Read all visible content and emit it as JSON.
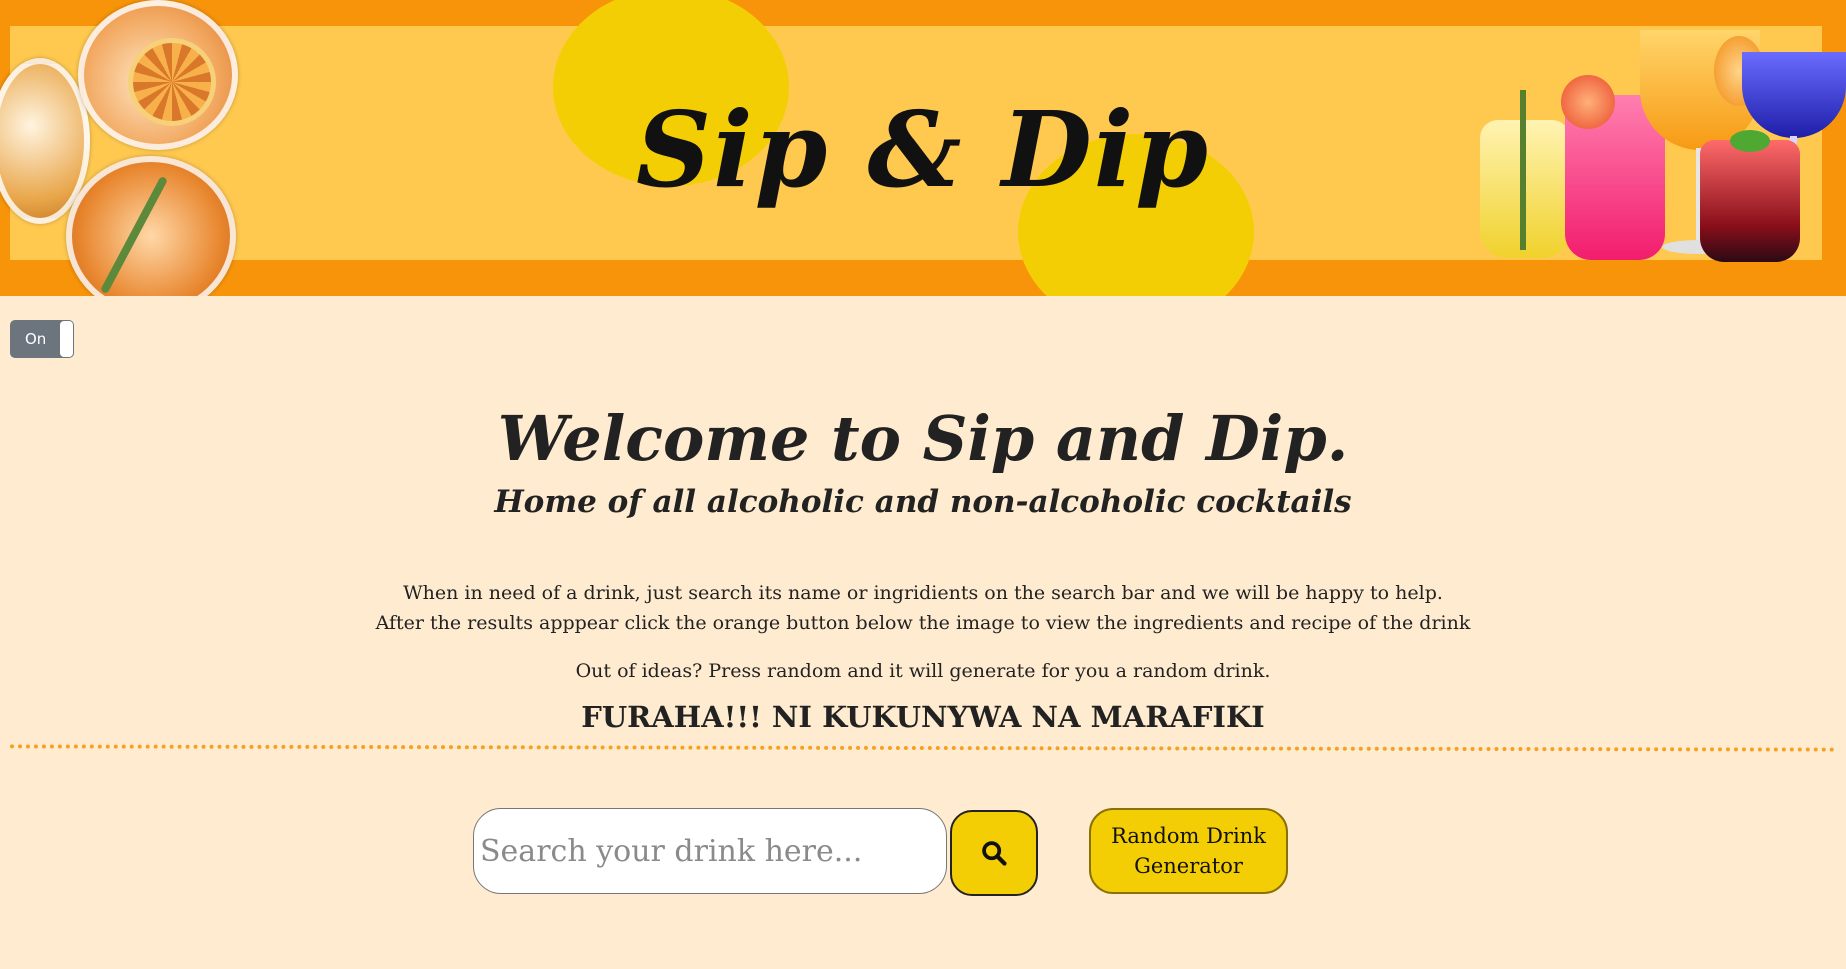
{
  "header": {
    "title": "Sip & Dip"
  },
  "theme_toggle": {
    "label": "On"
  },
  "intro": {
    "heading": "Welcome to Sip and Dip.",
    "subheading": "Home of all alcoholic and non-alcoholic cocktails",
    "line1": "When in need of a drink, just search its name or ingridients on the search bar and we will be happy to help.",
    "line2": "After the results apppear click the orange button below the image to view the ingredients and recipe of the drink",
    "line3": "Out of ideas? Press random and it will generate for you a random drink.",
    "motto": "FURAHA!!! NI KUKUNYWA NA MARAFIKI"
  },
  "search": {
    "value": "",
    "placeholder": "Search your drink here..."
  },
  "random_button": {
    "label": "Random Drink Generator"
  },
  "colors": {
    "page_background": "#ffecd0",
    "header_border": "#f7940a",
    "header_fill": "#ffc94f",
    "accent_yellow": "#f4ce05",
    "toggle_gray": "#6c757d"
  },
  "icons": {
    "search_button": "search-icon"
  }
}
